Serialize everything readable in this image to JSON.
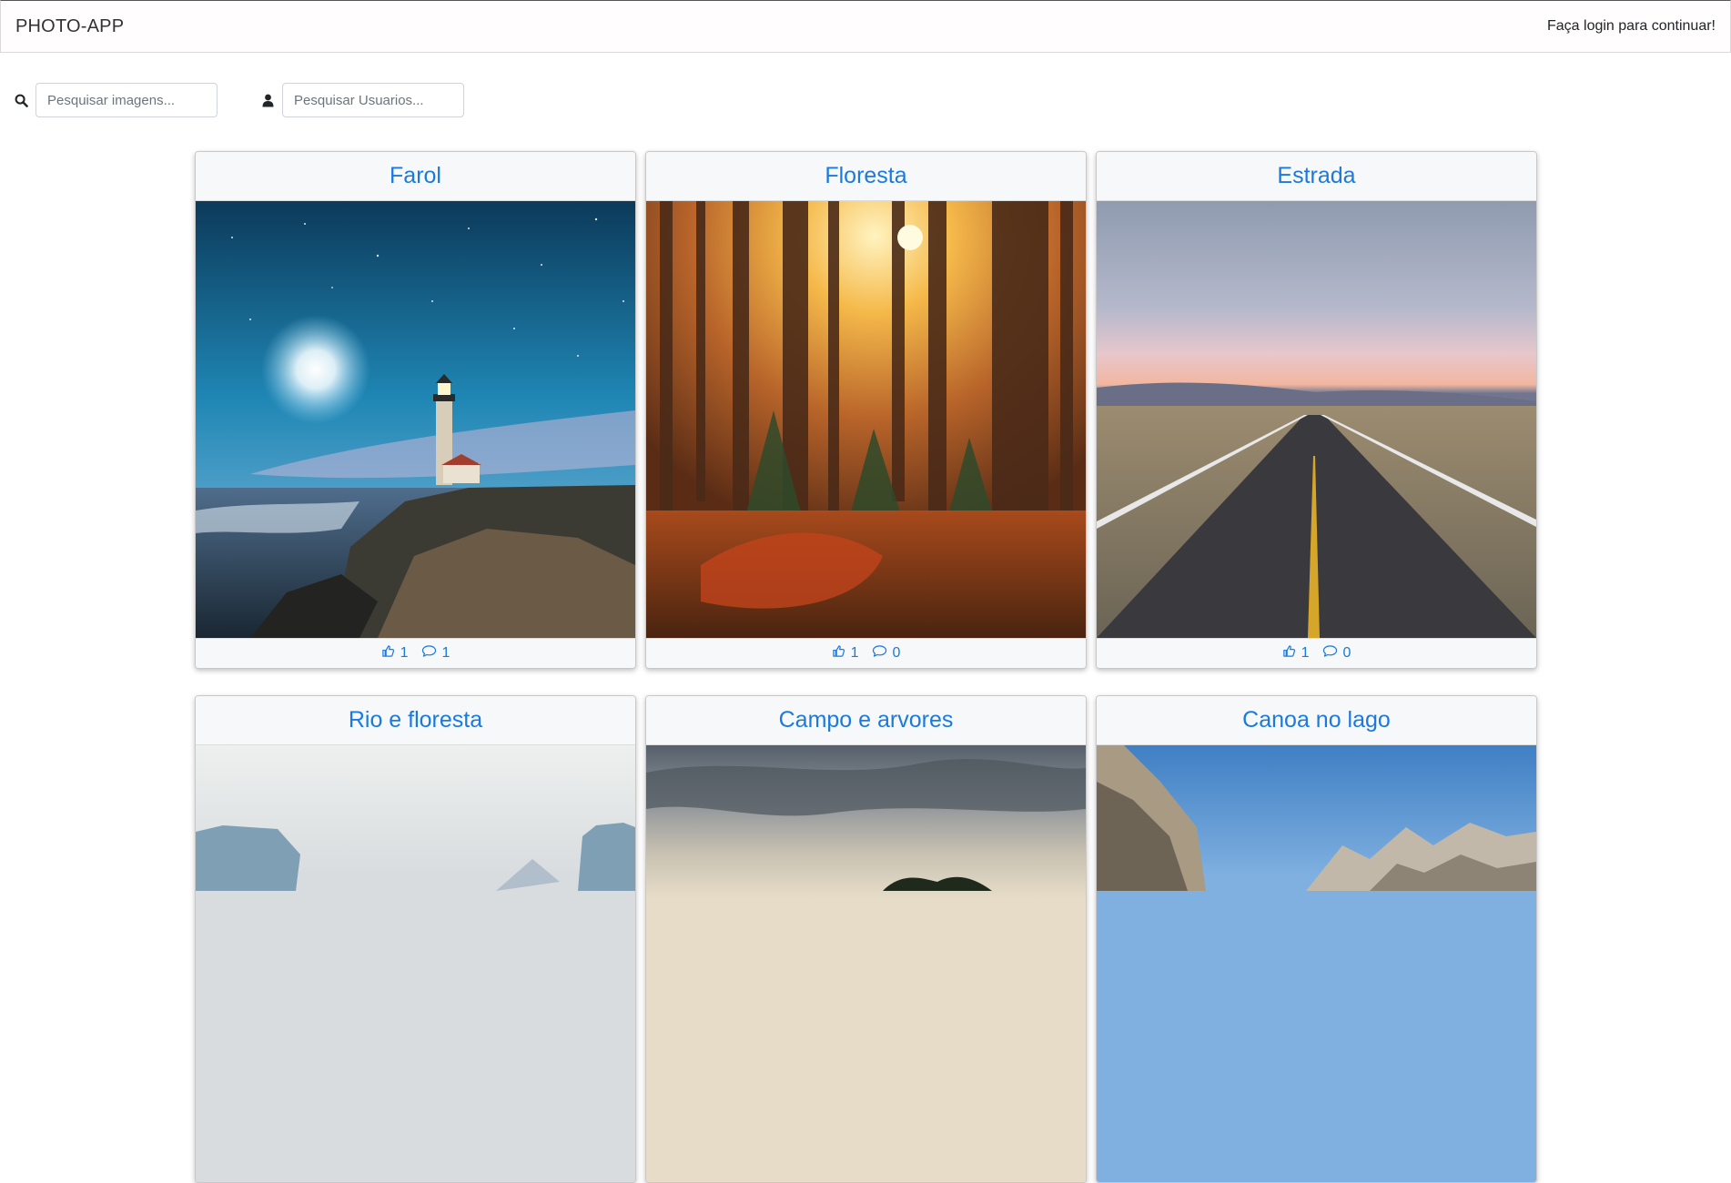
{
  "navbar": {
    "brand": "PHOTO-APP",
    "login_message": "Faça login para continuar!"
  },
  "search": {
    "images_placeholder": "Pesquisar imagens...",
    "users_placeholder": "Pesquisar Usuarios..."
  },
  "icons": {
    "search": "search-icon",
    "user": "user-icon",
    "like": "thumbs-up-icon",
    "comment": "comment-icon"
  },
  "colors": {
    "accent": "#1a7ae0"
  },
  "cards": [
    {
      "title": "Farol",
      "likes": "1",
      "comments": "1"
    },
    {
      "title": "Floresta",
      "likes": "1",
      "comments": "0"
    },
    {
      "title": "Estrada",
      "likes": "1",
      "comments": "0"
    },
    {
      "title": "Rio e floresta"
    },
    {
      "title": "Campo e arvores"
    },
    {
      "title": "Canoa no lago"
    }
  ]
}
